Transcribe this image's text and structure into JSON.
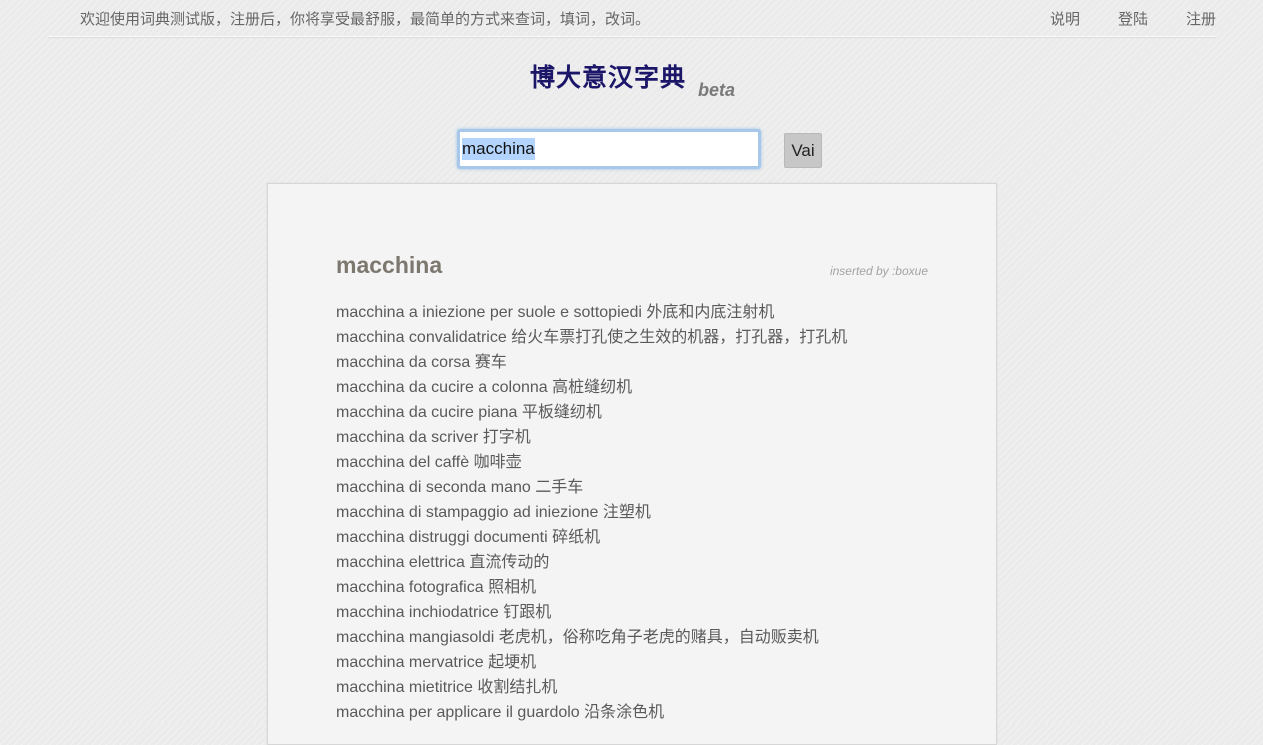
{
  "topbar": {
    "welcome": "欢迎使用词典测试版，注册后，你将享受最舒服，最简单的方式来查词，填词，改词。",
    "links": [
      "说明",
      "登陆",
      "注册"
    ]
  },
  "logo": {
    "name": "博大意汉字典",
    "tag": "beta"
  },
  "search": {
    "value": "macchina",
    "button": "Vai"
  },
  "entry": {
    "title": "macchina",
    "inserted_by": "inserted by :boxue",
    "definitions": [
      {
        "term": "macchina a iniezione per suole e sottopiedi",
        "translation": "外底和内底注射机"
      },
      {
        "term": "macchina convalidatrice",
        "translation": "给火车票打孔使之生效的机器，打孔器，打孔机"
      },
      {
        "term": "macchina da corsa",
        "translation": "赛车"
      },
      {
        "term": "macchina da cucire a colonna",
        "translation": "高桩缝纫机"
      },
      {
        "term": "macchina da cucire piana",
        "translation": "平板缝纫机"
      },
      {
        "term": "macchina da scriver",
        "translation": "打字机"
      },
      {
        "term": "macchina del caffè",
        "translation": "咖啡壶"
      },
      {
        "term": "macchina di seconda mano",
        "translation": "二手车"
      },
      {
        "term": "macchina di stampaggio ad iniezione",
        "translation": "注塑机"
      },
      {
        "term": "macchina distruggi documenti",
        "translation": "碎纸机"
      },
      {
        "term": "macchina elettrica",
        "translation": "直流传动的"
      },
      {
        "term": "macchina fotografica",
        "translation": "照相机"
      },
      {
        "term": "macchina inchiodatrice",
        "translation": "钉跟机"
      },
      {
        "term": "macchina mangiasoldi",
        "translation": "老虎机，俗称吃角子老虎的赌具，自动贩卖机"
      },
      {
        "term": "macchina mervatrice",
        "translation": "起埂机"
      },
      {
        "term": "macchina mietitrice",
        "translation": "收割结扎机"
      },
      {
        "term": "macchina per applicare il guardolo",
        "translation": "沿条涂色机"
      }
    ]
  }
}
